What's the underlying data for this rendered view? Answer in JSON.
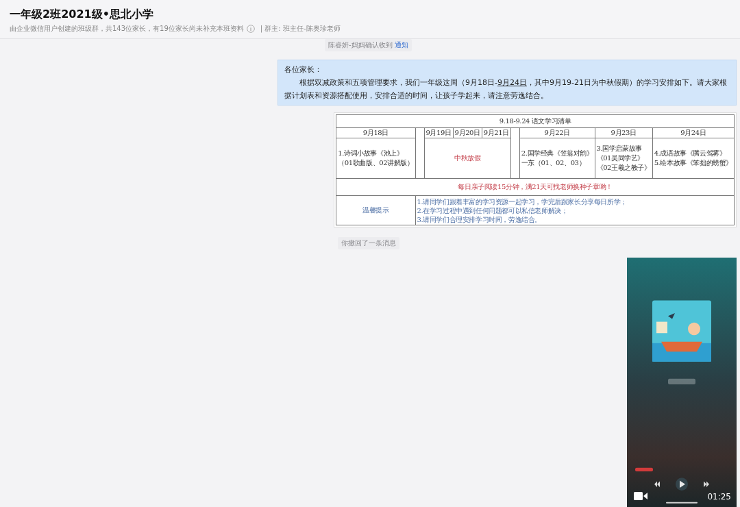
{
  "header": {
    "title": "一年级2班2021级•思北小学",
    "subtitle": "由企业微信用户创建的班级群，共143位家长，有19位家长尚未补充本班资料",
    "owner": "| 群主: 班主任-陈奥珍老师"
  },
  "messages": [
    {
      "kind": "notice",
      "text": "陈睿妍-妈妈确认收到",
      "link": "通知"
    },
    {
      "kind": "text",
      "greeting": "各位家长：",
      "body": {
        "before": "根据双减政策和五项管理要求，我们一年级这周（9月18日-",
        "link": "9月24日",
        "after": "，其中9月19-21日为中秋假期）的学习安排如下。请大家根据计划表和资源搭配使用，安排合适的时间，让孩子学起来，请注意劳逸结合。"
      }
    },
    {
      "kind": "table_image",
      "table": {
        "title": "9.18-9.24  语文学习清单",
        "header": [
          {
            "kind": "day",
            "text": "9月18日"
          },
          {
            "kind": "gap"
          },
          {
            "kind": "day",
            "text": "9月19日"
          },
          {
            "kind": "day",
            "text": "9月20日"
          },
          {
            "kind": "day",
            "text": "9月21日"
          },
          {
            "kind": "gap"
          },
          {
            "kind": "day",
            "text": "9月22日"
          },
          {
            "kind": "day",
            "text": "9月23日"
          },
          {
            "kind": "day",
            "text": "9月24日"
          }
        ],
        "body": [
          {
            "kind": "task",
            "lines": [
              "1.诗词小故事《池上》",
              "（01歌曲版、02讲解版）"
            ]
          },
          {
            "kind": "gap"
          },
          {
            "kind": "holiday",
            "text": "中秋放假"
          },
          {
            "kind": "gap"
          },
          {
            "kind": "task",
            "lines": [
              "2.国学经典《笠翁对韵》",
              "一东（01、02、03）"
            ]
          },
          {
            "kind": "task",
            "lines": [
              "3.国学启蒙故事",
              "《01吴同学艺》",
              "《02王羲之教子》"
            ]
          },
          {
            "kind": "task",
            "lines": [
              "4.成语故事《腾云驾雾》",
              "5.绘本故事《笨拙的螃蟹》"
            ]
          }
        ],
        "reading": "每日亲子阅读15分钟，满21天可找老师换种子章哟！",
        "tips_label": "温馨提示",
        "tips": [
          "1.请同学们跟着丰富的学习资源一起学习，学完后跟家长分享每日所学；",
          "2.在学习过程中遇到任何问题都可以私信老师解决；",
          "3.请同学们合理安排学习时间，劳逸结合。"
        ]
      }
    },
    {
      "kind": "notice",
      "text": "你撤回了一条消息"
    },
    {
      "kind": "video",
      "duration": "01:25"
    }
  ]
}
